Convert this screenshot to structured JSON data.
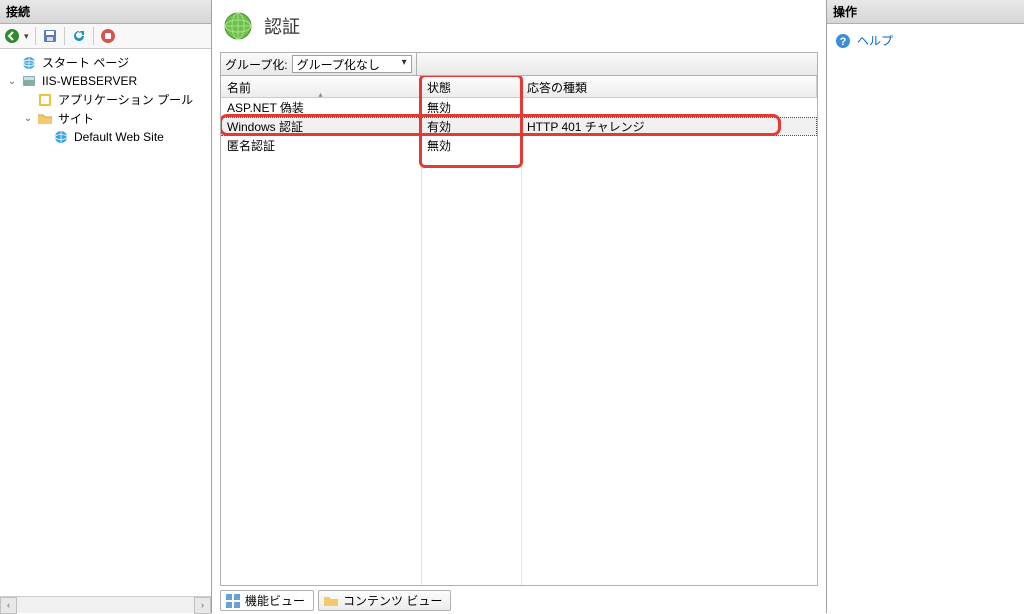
{
  "left": {
    "header": "接続",
    "toolbar": [
      "nav",
      "save",
      "refresh",
      "stop"
    ],
    "tree": [
      {
        "level": 1,
        "exp": "none",
        "icon": "start",
        "label": "スタート ページ"
      },
      {
        "level": 1,
        "exp": "open",
        "icon": "server",
        "label": "IIS-WEBSERVER"
      },
      {
        "level": 2,
        "exp": "none",
        "icon": "apppool",
        "label": "アプリケーション プール"
      },
      {
        "level": 2,
        "exp": "open",
        "icon": "sites",
        "label": "サイト"
      },
      {
        "level": 3,
        "exp": "none",
        "icon": "site",
        "label": "Default Web Site"
      }
    ]
  },
  "center": {
    "title": "認証",
    "group_label": "グループ化:",
    "group_value": "グループ化なし",
    "columns": {
      "name": "名前",
      "status": "状態",
      "response": "応答の種類"
    },
    "rows": [
      {
        "name": "ASP.NET 偽装",
        "status": "無効",
        "response": ""
      },
      {
        "name": "Windows 認証",
        "status": "有効",
        "response": "HTTP 401 チャレンジ",
        "selected": true
      },
      {
        "name": "匿名認証",
        "status": "無効",
        "response": ""
      }
    ],
    "tabs": {
      "features": "機能ビュー",
      "content": "コンテンツ ビュー"
    }
  },
  "right": {
    "header": "操作",
    "help": "ヘルプ"
  }
}
